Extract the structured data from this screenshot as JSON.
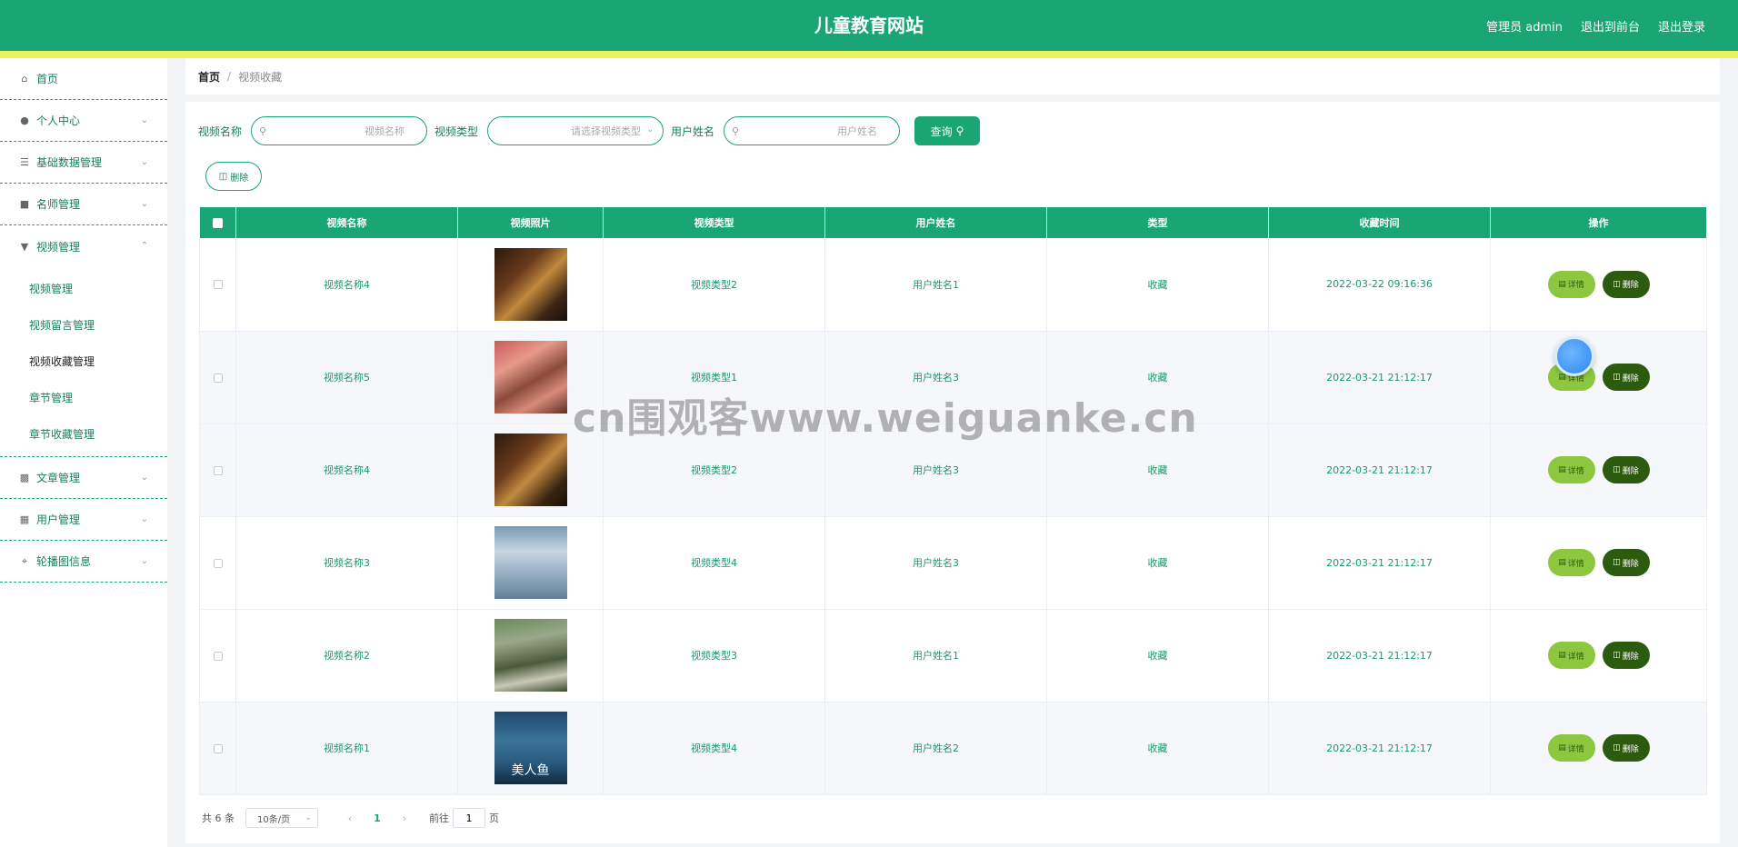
{
  "header": {
    "title": "儿童教育网站",
    "links": [
      "管理员 admin",
      "退出到前台",
      "退出登录"
    ]
  },
  "sidebar": {
    "items": [
      {
        "label": "首页",
        "icon": "home-icon"
      },
      {
        "label": "个人中心",
        "icon": "user-icon"
      },
      {
        "label": "基础数据管理",
        "icon": "list-icon"
      },
      {
        "label": "名师管理",
        "icon": "comment-icon"
      },
      {
        "label": "视频管理",
        "icon": "stamp-icon"
      },
      {
        "label": "文章管理",
        "icon": "bar-chart-icon"
      },
      {
        "label": "用户管理",
        "icon": "grid-icon"
      },
      {
        "label": "轮播图信息",
        "icon": "crop-icon"
      }
    ],
    "submenu": [
      "视频管理",
      "视频留言管理",
      "视频收藏管理",
      "章节管理",
      "章节收藏管理"
    ]
  },
  "breadcrumb": {
    "home": "首页",
    "separator": "/",
    "current": "视频收藏"
  },
  "search": {
    "name_label": "视频名称",
    "name_placeholder": "视频名称",
    "type_label": "视频类型",
    "type_placeholder": "请选择视频类型",
    "user_label": "用户姓名",
    "user_placeholder": "用户姓名",
    "query_label": "查询"
  },
  "batch_delete_label": "删除",
  "table": {
    "headers": [
      "视频名称",
      "视频照片",
      "视频类型",
      "用户姓名",
      "类型",
      "收藏时间",
      "操作"
    ],
    "rows": [
      {
        "name": "视频名称4",
        "type": "视频类型2",
        "user": "用户姓名1",
        "kind": "收藏",
        "time": "2022-03-22 09:16:36"
      },
      {
        "name": "视频名称5",
        "type": "视频类型1",
        "user": "用户姓名3",
        "kind": "收藏",
        "time": "2022-03-21 21:12:17"
      },
      {
        "name": "视频名称4",
        "type": "视频类型2",
        "user": "用户姓名3",
        "kind": "收藏",
        "time": "2022-03-21 21:12:17"
      },
      {
        "name": "视频名称3",
        "type": "视频类型4",
        "user": "用户姓名3",
        "kind": "收藏",
        "time": "2022-03-21 21:12:17"
      },
      {
        "name": "视频名称2",
        "type": "视频类型3",
        "user": "用户姓名1",
        "kind": "收藏",
        "time": "2022-03-21 21:12:17"
      },
      {
        "name": "视频名称1",
        "type": "视频类型4",
        "user": "用户姓名2",
        "kind": "收藏",
        "time": "2022-03-21 21:12:17"
      }
    ],
    "detail_label": "详情",
    "delete_label": "删除",
    "poster_text": "美人鱼"
  },
  "pager": {
    "total": "共 6 条",
    "page_size": "10条/页",
    "current_page": "1",
    "goto_label": "前往",
    "goto_value": "1",
    "page_unit": "页"
  },
  "watermark": "cn围观客www.weiguanke.cn",
  "colors": {
    "primary": "#1aa574",
    "stripe": "#eaf35e",
    "detail": "#8dc63f",
    "delete": "#2c5a0e"
  }
}
